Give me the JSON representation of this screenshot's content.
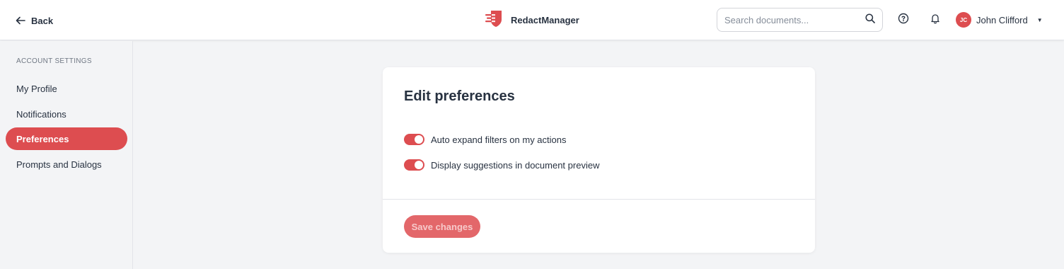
{
  "header": {
    "back_label": "Back",
    "brand_name": "RedactManager",
    "search": {
      "placeholder": "Search documents...",
      "value": ""
    },
    "help_icon": "question-circle-icon",
    "notifications_icon": "bell-icon",
    "user": {
      "initials": "JC",
      "name": "John Clifford"
    }
  },
  "sidebar": {
    "heading": "ACCOUNT SETTINGS",
    "items": [
      {
        "label": "My Profile",
        "active": false
      },
      {
        "label": "Notifications",
        "active": false
      },
      {
        "label": "Preferences",
        "active": true
      },
      {
        "label": "Prompts and Dialogs",
        "active": false
      }
    ]
  },
  "main": {
    "title": "Edit preferences",
    "preferences": [
      {
        "label": "Auto expand filters on my actions",
        "enabled": true
      },
      {
        "label": "Display suggestions in document preview",
        "enabled": true
      }
    ],
    "save_label": "Save changes",
    "save_disabled": true
  },
  "colors": {
    "accent": "#dd4d50",
    "background": "#f3f4f6",
    "text": "#283241"
  }
}
